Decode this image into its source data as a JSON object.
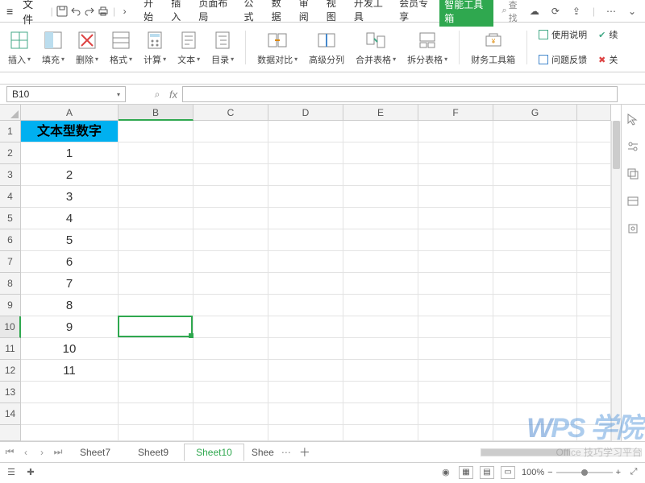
{
  "menubar": {
    "file_label": "文件",
    "tabs": [
      "开始",
      "插入",
      "页面布局",
      "公式",
      "数据",
      "审阅",
      "视图",
      "开发工具",
      "会员专享"
    ],
    "highlight_tab": "智能工具箱",
    "search_placeholder": "查找"
  },
  "ribbon": {
    "groups": [
      {
        "label": "插入",
        "dd": true
      },
      {
        "label": "填充",
        "dd": true
      },
      {
        "label": "删除",
        "dd": true
      },
      {
        "label": "格式",
        "dd": true
      },
      {
        "label": "计算",
        "dd": true
      },
      {
        "label": "文本",
        "dd": true
      },
      {
        "label": "目录",
        "dd": true
      }
    ],
    "groups2": [
      {
        "label": "数据对比",
        "dd": true
      },
      {
        "label": "高级分列"
      },
      {
        "label": "合并表格",
        "dd": true
      },
      {
        "label": "拆分表格",
        "dd": true
      }
    ],
    "groups3": [
      {
        "label": "财务工具箱"
      }
    ],
    "side": {
      "help": "使用说明",
      "feedback": "问题反馈",
      "resume": "续",
      "close": "关"
    }
  },
  "namebox": {
    "value": "B10"
  },
  "fx": {
    "label": "fx"
  },
  "grid": {
    "columns": [
      "A",
      "B",
      "C",
      "D",
      "E",
      "F",
      "G"
    ],
    "row_numbers": [
      1,
      2,
      3,
      4,
      5,
      6,
      7,
      8,
      9,
      10,
      11,
      12,
      13,
      14
    ],
    "active": {
      "row": 10,
      "col": "B"
    },
    "cells": {
      "A1": "文本型数字",
      "A2": "1",
      "A3": "2",
      "A4": "3",
      "A5": "4",
      "A6": "5",
      "A7": "6",
      "A8": "7",
      "A9": "8",
      "A10": "9",
      "A11": "10",
      "A12": "11"
    }
  },
  "sheets": {
    "tabs": [
      "Sheet7",
      "Sheet9",
      "Sheet10",
      "Shee"
    ],
    "active": "Sheet10"
  },
  "statusbar": {
    "zoom": "100%"
  },
  "watermark": {
    "brand_prefix": "W",
    "brand_rest": "PS 学院",
    "sub": "Office 技巧学习平台"
  }
}
